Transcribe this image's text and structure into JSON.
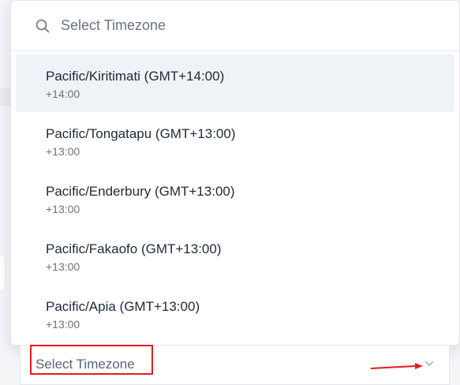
{
  "search": {
    "placeholder": "Select Timezone",
    "icon": "search-icon"
  },
  "options": [
    {
      "title": "Pacific/Kiritimati (GMT+14:00)",
      "offset": "+14:00",
      "selected": true
    },
    {
      "title": "Pacific/Tongatapu (GMT+13:00)",
      "offset": "+13:00",
      "selected": false
    },
    {
      "title": "Pacific/Enderbury (GMT+13:00)",
      "offset": "+13:00",
      "selected": false
    },
    {
      "title": "Pacific/Fakaofo (GMT+13:00)",
      "offset": "+13:00",
      "selected": false
    },
    {
      "title": "Pacific/Apia (GMT+13:00)",
      "offset": "+13:00",
      "selected": false
    }
  ],
  "select": {
    "placeholder": "Select Timezone",
    "icon": "chevron-down-icon"
  },
  "annotations": {
    "highlight_color": "#e11d1d",
    "arrow_icon": "arrow-right-icon"
  }
}
